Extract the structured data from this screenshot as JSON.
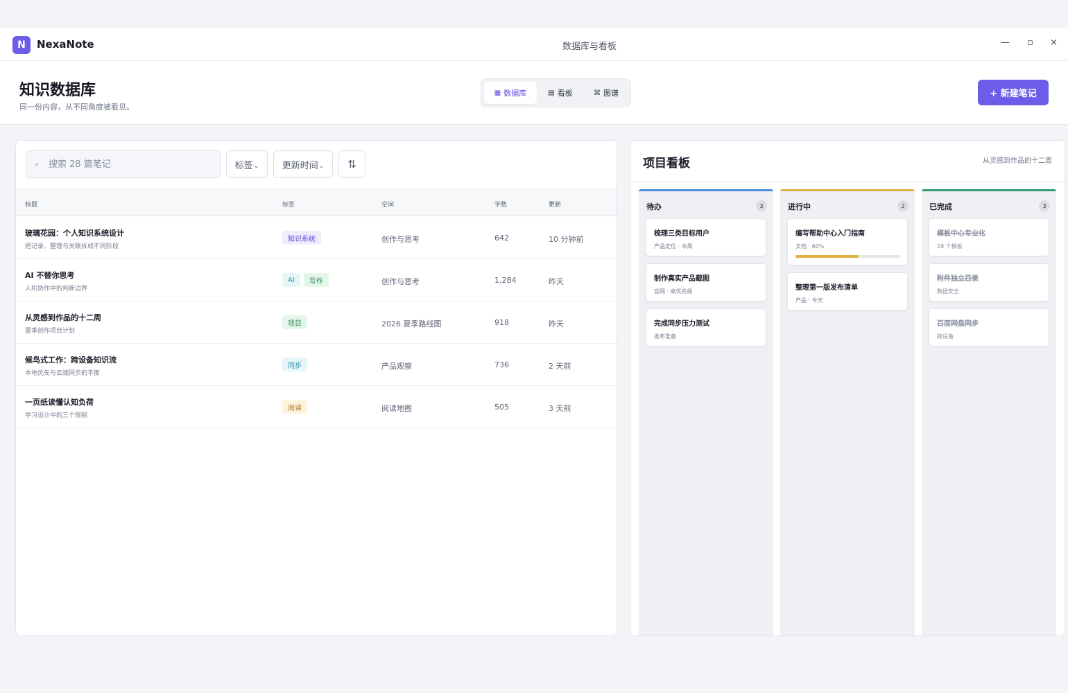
{
  "app": {
    "logo_letter": "N",
    "name": "NexaNote",
    "window_title": "数据库与看板"
  },
  "window_controls": {
    "minimize": "—",
    "maximize": "▫",
    "close": "×"
  },
  "header": {
    "title": "知识数据库",
    "subtitle": "同一份内容，从不同角度被看见。",
    "views": [
      {
        "icon": "▦",
        "label": "数据库",
        "active": true
      },
      {
        "icon": "▤",
        "label": "看板",
        "active": false
      },
      {
        "icon": "⌘",
        "label": "图谱",
        "active": false
      }
    ],
    "new_button": "+ 新建笔记"
  },
  "toolbar": {
    "search_placeholder": "搜索 28 篇笔记",
    "tag_filter": "标签",
    "time_filter": "更新时间",
    "sort_icon": "⇅"
  },
  "table": {
    "columns": [
      "标题",
      "标签",
      "空间",
      "字数",
      "更新"
    ],
    "rows": [
      {
        "title": "玻璃花园：个人知识系统设计",
        "desc": "把记录、整理与关联拆成不同阶段",
        "tags": [
          {
            "label": "知识系统",
            "color": "#5b4ae0",
            "bg": "#efecfd"
          }
        ],
        "space": "创作与思考",
        "words": "642",
        "updated": "10 分钟前"
      },
      {
        "title": "AI 不替你思考",
        "desc": "人机协作中的判断边界",
        "tags": [
          {
            "label": "AI",
            "color": "#2a8fa3",
            "bg": "#e5f6f8"
          },
          {
            "label": "写作",
            "color": "#2f8a5a",
            "bg": "#e4f5ea"
          }
        ],
        "space": "创作与思考",
        "words": "1,284",
        "updated": "昨天"
      },
      {
        "title": "从灵感到作品的十二周",
        "desc": "夏季创作项目计划",
        "tags": [
          {
            "label": "项目",
            "color": "#2f8a5a",
            "bg": "#e4f5ea"
          }
        ],
        "space": "2026 夏季路线图",
        "words": "918",
        "updated": "昨天"
      },
      {
        "title": "候鸟式工作：跨设备知识流",
        "desc": "本地优先与云端同步的平衡",
        "tags": [
          {
            "label": "同步",
            "color": "#2a8fa3",
            "bg": "#e5f6f8"
          }
        ],
        "space": "产品观察",
        "words": "736",
        "updated": "2 天前"
      },
      {
        "title": "一页纸读懂认知负荷",
        "desc": "学习设计中的三个限制",
        "tags": [
          {
            "label": "阅读",
            "color": "#b7791f",
            "bg": "#fdf3df"
          }
        ],
        "space": "阅读地图",
        "words": "505",
        "updated": "3 天前"
      }
    ]
  },
  "kanban": {
    "title": "项目看板",
    "subtitle": "从灵感到作品的十二周",
    "columns": [
      {
        "name": "待办",
        "count": "3",
        "color": "#4a90e2",
        "cards": [
          {
            "title": "梳理三类目标用户",
            "meta": "产品定位 · 本周"
          },
          {
            "title": "制作真实产品截图",
            "meta": "官网 · 高优先级"
          },
          {
            "title": "完成同步压力测试",
            "meta": "发布准备"
          }
        ]
      },
      {
        "name": "进行中",
        "count": "2",
        "color": "#e0b042",
        "cards": [
          {
            "title": "编写帮助中心入门指南",
            "meta": "文档 · 60%",
            "progress": 0.6
          },
          {
            "title": "整理第一版发布清单",
            "meta": "产品 · 今天"
          }
        ]
      },
      {
        "name": "已完成",
        "count": "3",
        "color": "#2f9e6e",
        "cards": [
          {
            "title": "模板中心专业化",
            "meta": "28 个模板"
          },
          {
            "title": "附件独立目录",
            "meta": "数据安全"
          },
          {
            "title": "百度网盘同步",
            "meta": "跨设备"
          }
        ]
      }
    ]
  }
}
